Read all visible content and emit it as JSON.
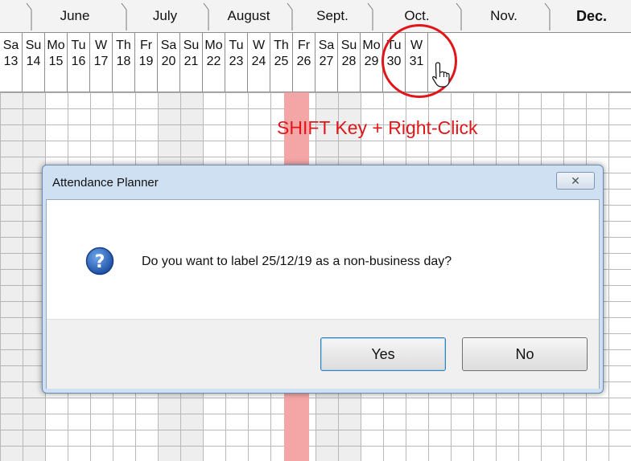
{
  "months": [
    "June",
    "July",
    "August",
    "Sept.",
    "Oct.",
    "Nov.",
    "Dec."
  ],
  "days": [
    {
      "dow": "Sa",
      "num": "13",
      "weekend": true
    },
    {
      "dow": "Su",
      "num": "14",
      "weekend": true
    },
    {
      "dow": "Mo",
      "num": "15",
      "weekend": false
    },
    {
      "dow": "Tu",
      "num": "16",
      "weekend": false
    },
    {
      "dow": "W",
      "num": "17",
      "weekend": false
    },
    {
      "dow": "Th",
      "num": "18",
      "weekend": false
    },
    {
      "dow": "Fr",
      "num": "19",
      "weekend": false
    },
    {
      "dow": "Sa",
      "num": "20",
      "weekend": true
    },
    {
      "dow": "Su",
      "num": "21",
      "weekend": true
    },
    {
      "dow": "Mo",
      "num": "22",
      "weekend": false
    },
    {
      "dow": "Tu",
      "num": "23",
      "weekend": false
    },
    {
      "dow": "W",
      "num": "24",
      "weekend": false
    },
    {
      "dow": "Th",
      "num": "25",
      "weekend": false
    },
    {
      "dow": "Fr",
      "num": "26",
      "weekend": false,
      "holiday": true
    },
    {
      "dow": "Sa",
      "num": "27",
      "weekend": true
    },
    {
      "dow": "Su",
      "num": "28",
      "weekend": true
    },
    {
      "dow": "Mo",
      "num": "29",
      "weekend": false
    },
    {
      "dow": "Tu",
      "num": "30",
      "weekend": false
    },
    {
      "dow": "W",
      "num": "31",
      "weekend": false
    }
  ],
  "annotation": "SHIFT Key + Right-Click",
  "dialog": {
    "title": "Attendance Planner",
    "message": "Do you want to label 25/12/19 as a non-business day?",
    "yes_label": "Yes",
    "no_label": "No",
    "close_glyph": "✕"
  },
  "colors": {
    "annotation": "#e0161b",
    "holiday_column": "#f4a6a6",
    "dialog_frame": "#cfe0f2"
  }
}
